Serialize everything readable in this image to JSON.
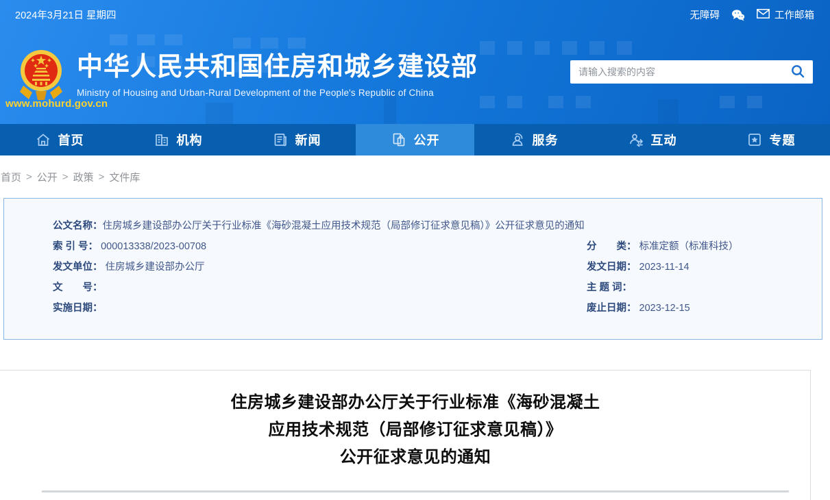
{
  "topbar": {
    "date": "2024年3月21日 星期四",
    "accessibility_label": "无障碍",
    "mailbox_label": "工作邮箱",
    "icons": [
      "wechat-icon",
      "mail-icon"
    ]
  },
  "header": {
    "site_url": "www.mohurd.gov.cn",
    "title": "中华人民共和国住房和城乡建设部",
    "subtitle": "Ministry of Housing and Urban-Rural Development of the People's Republic of China",
    "logo": "national-emblem-icon",
    "search": {
      "placeholder": "请输入搜索的内容",
      "icon": "search-icon"
    }
  },
  "nav": {
    "items": [
      {
        "label": "首页",
        "icon": "home-icon",
        "active": false
      },
      {
        "label": "机构",
        "icon": "organization-icon",
        "active": false
      },
      {
        "label": "新闻",
        "icon": "news-icon",
        "active": false
      },
      {
        "label": "公开",
        "icon": "disclosure-icon",
        "active": true
      },
      {
        "label": "服务",
        "icon": "services-icon",
        "active": false
      },
      {
        "label": "互动",
        "icon": "interaction-icon",
        "active": false
      },
      {
        "label": "专题",
        "icon": "topics-icon",
        "active": false
      }
    ]
  },
  "breadcrumb": {
    "separator": ">",
    "items": [
      "首页",
      "公开",
      "政策",
      "文件库"
    ]
  },
  "doc_meta": {
    "fields": {
      "doc_name": {
        "label": "公文名称：",
        "value": "住房城乡建设部办公厅关于行业标准《海砂混凝土应用技术规范（局部修订征求意见稿）》公开征求意见的通知"
      },
      "index_no": {
        "label": "索 引 号：",
        "value": "000013338/2023-00708"
      },
      "issuing_unit": {
        "label": "发文单位：",
        "value": "住房城乡建设部办公厅"
      },
      "doc_no": {
        "label": "文　　号：",
        "value": ""
      },
      "impl_date": {
        "label": "实施日期：",
        "value": ""
      },
      "category": {
        "label": "分　　类：",
        "value": "标准定额（标准科技）"
      },
      "issue_date": {
        "label": "发文日期：",
        "value": "2023-11-14"
      },
      "keywords": {
        "label": "主 题 词：",
        "value": ""
      },
      "repeal_date": {
        "label": "废止日期：",
        "value": "2023-12-15"
      }
    }
  },
  "article": {
    "title_lines": [
      "住房城乡建设部办公厅关于行业标准《海砂混凝土",
      "应用技术规范（局部修订征求意见稿）》",
      "公开征求意见的通知"
    ]
  },
  "colors": {
    "header_blue_light": "#2b8cee",
    "header_blue_dark": "#0a63c4",
    "nav_blue": "#085fb0",
    "nav_active_blue": "#2e8ada",
    "gold": "#fcd22f",
    "emblem_red": "#e02b12",
    "meta_bg": "#f6fafe",
    "meta_border": "#8ab6e4",
    "meta_text_navy": "#2e4a7d",
    "breadcrumb_gray": "#8f9398",
    "title_black": "#0d0d0d",
    "hr_gray": "#d3d7db"
  }
}
